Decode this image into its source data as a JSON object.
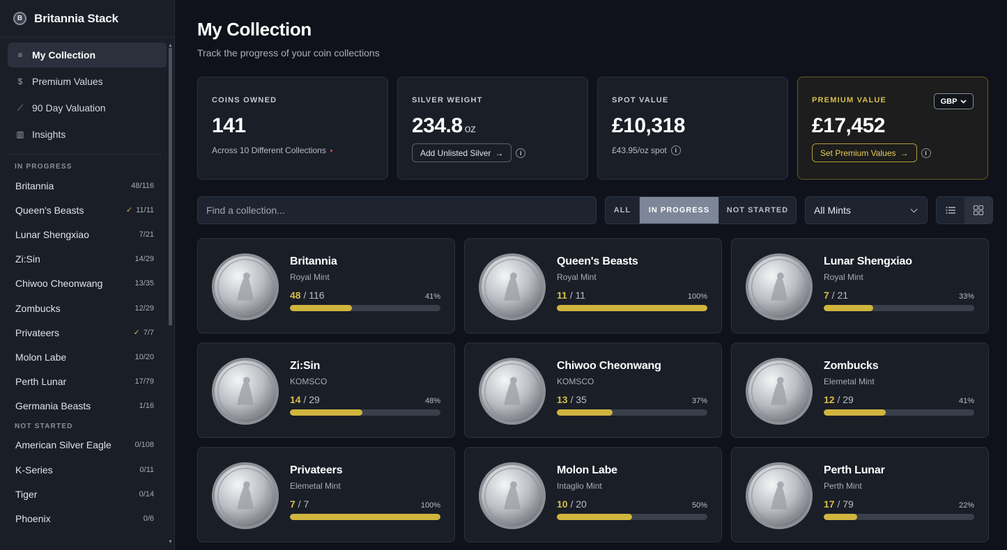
{
  "brand": {
    "logo_letter": "B",
    "name": "Britannia Stack"
  },
  "nav": [
    {
      "label": "My Collection",
      "icon": "database-icon",
      "glyph": "≡",
      "active": true
    },
    {
      "label": "Premium Values",
      "icon": "dollar-icon",
      "glyph": "$",
      "active": false
    },
    {
      "label": "90 Day Valuation",
      "icon": "line-chart-icon",
      "glyph": "⟋",
      "active": false
    },
    {
      "label": "Insights",
      "icon": "bar-chart-icon",
      "glyph": "▥",
      "active": false
    }
  ],
  "sidebar": {
    "in_progress_label": "IN PROGRESS",
    "not_started_label": "NOT STARTED",
    "in_progress": [
      {
        "name": "Britannia",
        "count": "48/116",
        "complete": false
      },
      {
        "name": "Queen's Beasts",
        "count": "11/11",
        "complete": true
      },
      {
        "name": "Lunar Shengxiao",
        "count": "7/21",
        "complete": false
      },
      {
        "name": "Zi:Sin",
        "count": "14/29",
        "complete": false
      },
      {
        "name": "Chiwoo Cheonwang",
        "count": "13/35",
        "complete": false
      },
      {
        "name": "Zombucks",
        "count": "12/29",
        "complete": false
      },
      {
        "name": "Privateers",
        "count": "7/7",
        "complete": true
      },
      {
        "name": "Molon Labe",
        "count": "10/20",
        "complete": false
      },
      {
        "name": "Perth Lunar",
        "count": "17/79",
        "complete": false
      },
      {
        "name": "Germania Beasts",
        "count": "1/16",
        "complete": false
      }
    ],
    "not_started": [
      {
        "name": "American Silver Eagle",
        "count": "0/108"
      },
      {
        "name": "K-Series",
        "count": "0/11"
      },
      {
        "name": "Tiger",
        "count": "0/14"
      },
      {
        "name": "Phoenix",
        "count": "0/6"
      }
    ]
  },
  "page": {
    "title": "My Collection",
    "subtitle": "Track the progress of your coin collections"
  },
  "stats": {
    "coins_owned": {
      "label": "COINS OWNED",
      "value": "141",
      "foot": "Across 10 Different Collections"
    },
    "silver_weight": {
      "label": "SILVER WEIGHT",
      "value": "234.8",
      "unit": "oz",
      "button": "Add Unlisted Silver"
    },
    "spot_value": {
      "label": "SPOT VALUE",
      "value": "£10,318",
      "foot": "£43.95/oz spot"
    },
    "premium_value": {
      "label": "PREMIUM VALUE",
      "value": "£17,452",
      "button": "Set Premium Values",
      "currency": "GBP"
    }
  },
  "toolbar": {
    "search_placeholder": "Find a collection...",
    "filters": [
      {
        "label": "ALL",
        "active": false
      },
      {
        "label": "IN PROGRESS",
        "active": true
      },
      {
        "label": "NOT STARTED",
        "active": false
      }
    ],
    "mint_select": "All Mints"
  },
  "cards": [
    {
      "name": "Britannia",
      "mint": "Royal Mint",
      "owned": "48",
      "total": "116",
      "pct": "41%",
      "progress": 0.41
    },
    {
      "name": "Queen's Beasts",
      "mint": "Royal Mint",
      "owned": "11",
      "total": "11",
      "pct": "100%",
      "progress": 1.0
    },
    {
      "name": "Lunar Shengxiao",
      "mint": "Royal Mint",
      "owned": "7",
      "total": "21",
      "pct": "33%",
      "progress": 0.33
    },
    {
      "name": "Zi:Sin",
      "mint": "KOMSCO",
      "owned": "14",
      "total": "29",
      "pct": "48%",
      "progress": 0.48
    },
    {
      "name": "Chiwoo Cheonwang",
      "mint": "KOMSCO",
      "owned": "13",
      "total": "35",
      "pct": "37%",
      "progress": 0.37
    },
    {
      "name": "Zombucks",
      "mint": "Elemetal Mint",
      "owned": "12",
      "total": "29",
      "pct": "41%",
      "progress": 0.41
    },
    {
      "name": "Privateers",
      "mint": "Elemetal Mint",
      "owned": "7",
      "total": "7",
      "pct": "100%",
      "progress": 1.0
    },
    {
      "name": "Molon Labe",
      "mint": "Intaglio Mint",
      "owned": "10",
      "total": "20",
      "pct": "50%",
      "progress": 0.5
    },
    {
      "name": "Perth Lunar",
      "mint": "Perth Mint",
      "owned": "17",
      "total": "79",
      "pct": "22%",
      "progress": 0.22
    }
  ],
  "colors": {
    "accent_gold": "#d0b53e",
    "background": "#0f121a",
    "panel": "#1a1e27"
  }
}
